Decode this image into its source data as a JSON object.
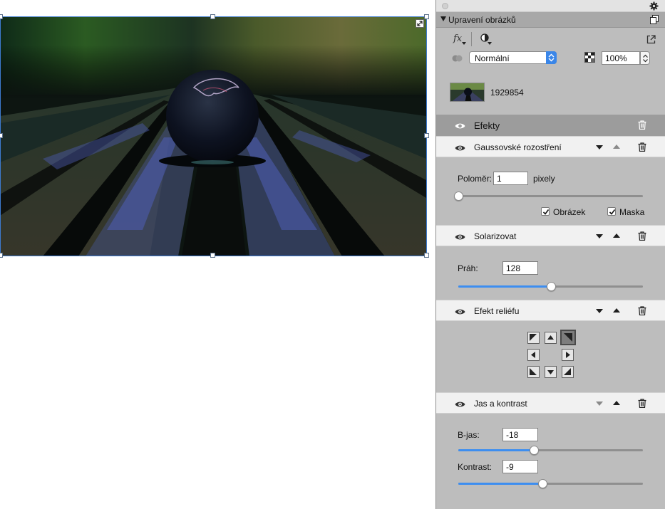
{
  "panel": {
    "title": "Upravení obrázků",
    "fx_label": "fx",
    "blend_mode": "Normální",
    "opacity": "100%"
  },
  "layer": {
    "name": "1929854"
  },
  "effects": {
    "title": "Efekty",
    "gaussian": {
      "name": "Gaussovské rozostření",
      "radius_label": "Poloměr:",
      "radius_value": "1",
      "unit": "pixely",
      "radius_level": 0.0,
      "image_label": "Obrázek",
      "image_checked": true,
      "mask_label": "Maska",
      "mask_checked": true
    },
    "solarize": {
      "name": "Solarizovat",
      "threshold_label": "Práh:",
      "threshold_value": "128",
      "threshold_level": 0.5
    },
    "emboss": {
      "name": "Efekt reliéfu",
      "selected_direction": "top-right"
    },
    "brightness": {
      "name": "Jas a kontrast",
      "brightness_label": "B-jas:",
      "brightness_value": "-18",
      "brightness_level": 0.41,
      "contrast_label": "Kontrast:",
      "contrast_value": "-9",
      "contrast_level": 0.455
    }
  },
  "colors": {
    "accent": "#3d8ef0",
    "panel_bg": "#bdbdbd",
    "selection_border": "#3d7bd1"
  }
}
